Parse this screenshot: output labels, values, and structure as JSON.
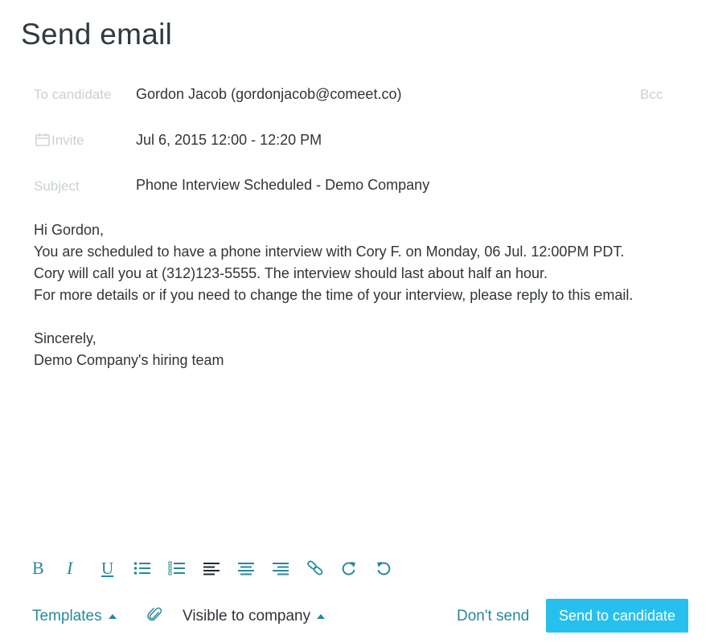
{
  "header": {
    "title": "Send email"
  },
  "fields": {
    "to": {
      "label": "To candidate",
      "value": "Gordon Jacob (gordonjacob@comeet.co)",
      "bcc_label": "Bcc"
    },
    "invite": {
      "label": "Invite",
      "icon": "calendar-icon",
      "value": "Jul 6, 2015 12:00 - 12:20 PM"
    },
    "subject": {
      "label": "Subject",
      "value": "Phone Interview Scheduled - Demo Company"
    }
  },
  "message": {
    "lines": [
      "Hi Gordon,",
      "You are scheduled to have a phone interview with Cory F. on Monday, 06 Jul. 12:00PM PDT.",
      "Cory will call you at (312)123-5555. The interview should last about half an hour.",
      "For more details or if you need to change the time of your interview, please reply to this email.",
      "",
      "Sincerely,",
      "Demo Company's hiring team"
    ]
  },
  "toolbar": {
    "bold": "B",
    "italic": "I",
    "underline": "U",
    "icons": [
      "bold-icon",
      "italic-icon",
      "underline-icon",
      "bullet-list-icon",
      "numbered-list-icon",
      "align-left-icon",
      "align-center-icon",
      "align-right-icon",
      "link-icon",
      "redo-icon",
      "undo-icon"
    ]
  },
  "footer": {
    "templates_label": "Templates",
    "visibility_label": "Visible to company",
    "dont_send_label": "Don't send",
    "send_label": "Send to candidate"
  },
  "colors": {
    "accent": "#27899a",
    "primary_button": "#27c0ee",
    "label_gray": "#c9d1d5",
    "text": "#2f353a"
  }
}
